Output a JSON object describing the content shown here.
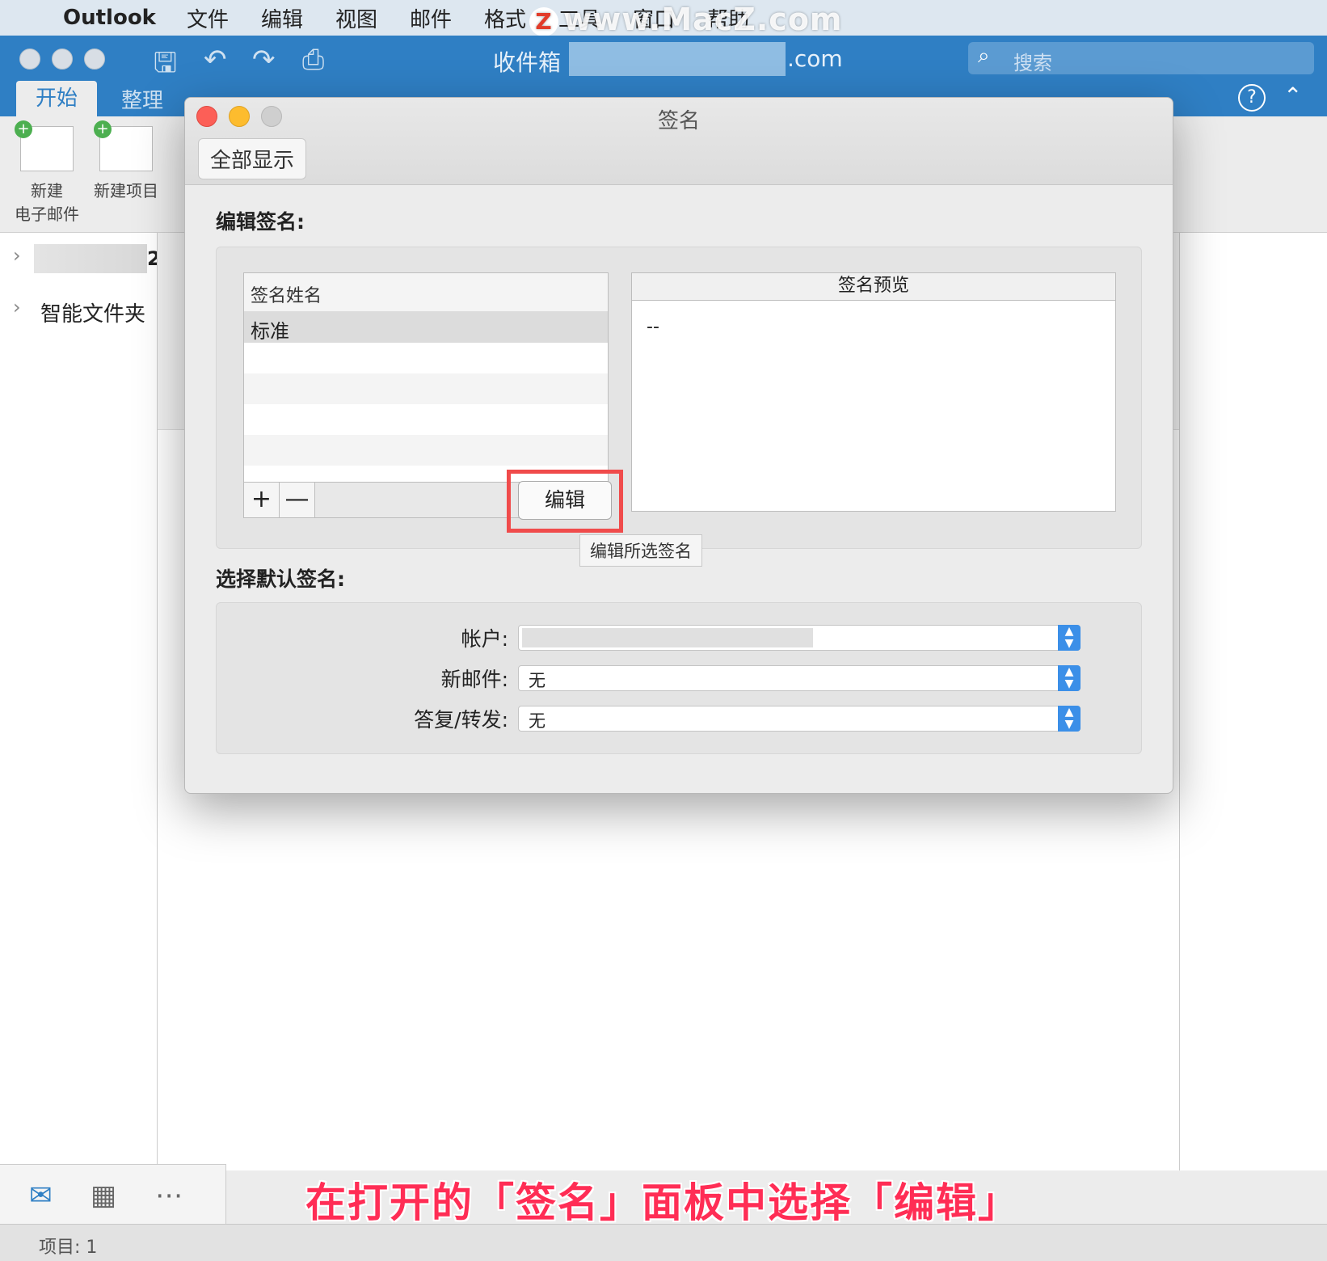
{
  "menubar": {
    "app": "Outlook",
    "items": [
      "文件",
      "编辑",
      "视图",
      "邮件",
      "格式",
      "工具",
      "窗口",
      "帮助"
    ],
    "watermark": "www.MacZ.com"
  },
  "window": {
    "title_prefix": "收件箱 •",
    "title_suffix": ".com",
    "search_placeholder": "搜索"
  },
  "ribbon": {
    "tabs": [
      "开始",
      "整理"
    ],
    "new_email_line1": "新建",
    "new_email_line2": "电子邮件",
    "new_item": "新建项目"
  },
  "sidebar": {
    "account_count": "2",
    "smart_folders": "智能文件夹"
  },
  "dialog": {
    "title": "签名",
    "show_all": "全部显示",
    "edit_section": "编辑签名:",
    "list_header": "签名姓名",
    "signatures": [
      "标准"
    ],
    "add_label": "+",
    "remove_label": "—",
    "edit_button": "编辑",
    "tooltip": "编辑所选签名",
    "preview_header": "签名预览",
    "preview_text": "--",
    "default_section": "选择默认签名:",
    "account_label": "帐户:",
    "new_mail_label": "新邮件:",
    "new_mail_value": "无",
    "reply_label": "答复/转发:",
    "reply_value": "无"
  },
  "statusbar": {
    "items": "项目: 1"
  },
  "caption": "在打开的「签名」面板中选择「编辑」",
  "colors": {
    "titlebar": "#2f7fc4",
    "highlight": "#f04b4b",
    "caption": "#ff2d55",
    "select_arrow": "#3b8fe8"
  }
}
